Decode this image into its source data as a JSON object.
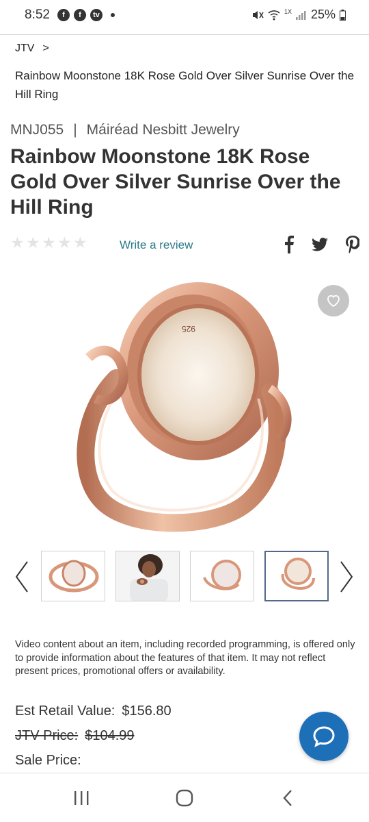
{
  "status_bar": {
    "time": "8:52",
    "left_icons": [
      "facebook-icon",
      "facebook-icon",
      "tv-icon"
    ],
    "battery": "25%",
    "network_tag": "1X"
  },
  "breadcrumb": {
    "root": "JTV",
    "separator": ">",
    "current": "Rainbow Moonstone 18K Rose Gold Over Silver Sunrise Over the Hill Ring"
  },
  "product": {
    "sku": "MNJ055",
    "separator": "|",
    "brand": "Máiréad Nesbitt Jewelry",
    "title": "Rainbow Moonstone 18K Rose Gold Over Silver Sunrise Over the Hill Ring",
    "rating_stars": 0,
    "review_link": "Write a review",
    "engraving": "925"
  },
  "social": [
    "facebook-icon",
    "twitter-icon",
    "pinterest-icon"
  ],
  "gallery": {
    "thumbnails": [
      "ring-front-view",
      "model-wearing-ring",
      "ring-side-view",
      "ring-back-view"
    ],
    "active_index": 3
  },
  "disclaimer": "Video content about an item, including recorded programming, is offered only to provide information about the features of that item. It may not reflect present prices, promotional offers or availability.",
  "pricing": {
    "est_label": "Est Retail Value:",
    "est_value": "$156.80",
    "jtv_label": "JTV Price:",
    "jtv_value": "$104.99",
    "sale_label": "Sale Price:"
  },
  "colors": {
    "accent_link": "#2a7a8a",
    "chat_fab": "#1d6fb8",
    "rose_gold": "#d9977a"
  }
}
